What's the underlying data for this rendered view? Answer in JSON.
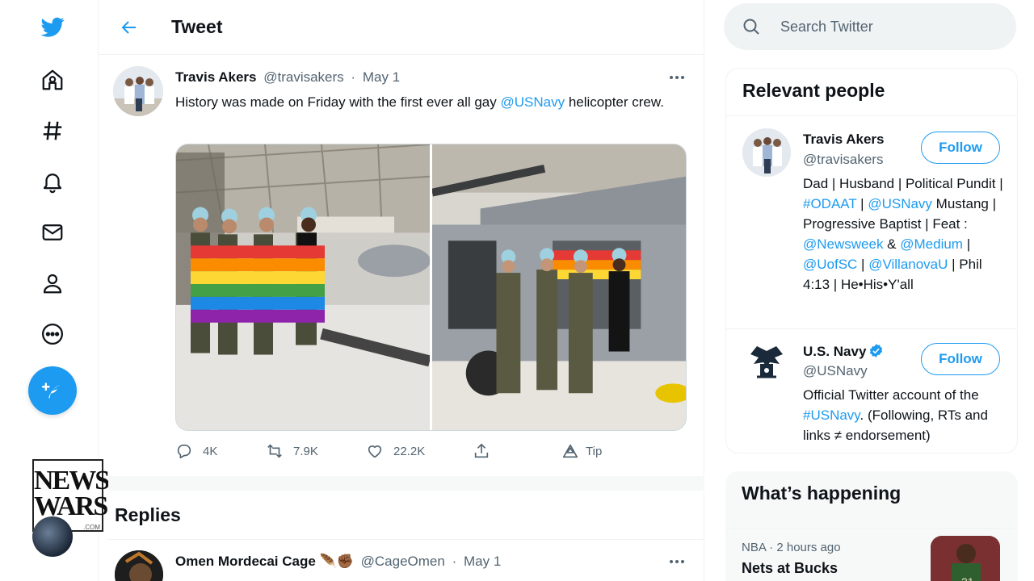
{
  "header": {
    "title": "Tweet"
  },
  "nav": {
    "items": [
      "twitter-logo",
      "home",
      "explore",
      "notifications",
      "messages",
      "profile",
      "more"
    ]
  },
  "overlay": {
    "brand_line1": "NEWS",
    "brand_line2": "WARS",
    "brand_domain": ".COM"
  },
  "tweet": {
    "author_name": "Travis Akers",
    "author_handle": "@travisakers",
    "date": "May 1",
    "text_before": "History was made on Friday with the first ever all gay ",
    "text_mention": "@USNavy",
    "text_after": " helicopter crew.",
    "stats": {
      "replies": "4K",
      "retweets": "7.9K",
      "likes": "22.2K",
      "tip": "Tip"
    }
  },
  "replies": {
    "title": "Replies",
    "first": {
      "author_name": "Omen Mordecai Cage",
      "emoji": "🪶✊🏾",
      "handle": "@CageOmen",
      "date": "May 1"
    }
  },
  "search": {
    "placeholder": "Search Twitter"
  },
  "relevant_people": {
    "title": "Relevant people",
    "people": [
      {
        "name": "Travis Akers",
        "handle": "@travisakers",
        "follow_label": "Follow",
        "bio_parts": [
          {
            "t": "Dad | Husband | Political Pundit | ",
            "link": false
          },
          {
            "t": "#ODAAT",
            "link": true
          },
          {
            "t": " | ",
            "link": false
          },
          {
            "t": "@USNavy",
            "link": true
          },
          {
            "t": " Mustang | Progressive Baptist | Feat : ",
            "link": false
          },
          {
            "t": "@Newsweek",
            "link": true
          },
          {
            "t": " & ",
            "link": false
          },
          {
            "t": "@Medium",
            "link": true
          },
          {
            "t": " | ",
            "link": false
          },
          {
            "t": "@UofSC",
            "link": true
          },
          {
            "t": " | ",
            "link": false
          },
          {
            "t": "@VillanovaU",
            "link": true
          },
          {
            "t": " | Phil 4:13 | He•His•Y'all",
            "link": false
          }
        ]
      },
      {
        "name": "U.S. Navy",
        "handle": "@USNavy",
        "follow_label": "Follow",
        "bio_parts": [
          {
            "t": "Official Twitter account of the ",
            "link": false
          },
          {
            "t": "#USNavy",
            "link": true
          },
          {
            "t": ". (Following, RTs and links ≠ endorsement)",
            "link": false
          }
        ]
      }
    ]
  },
  "whats_happening": {
    "title": "What’s happening",
    "trend": {
      "meta": "NBA · 2 hours ago",
      "title": "Nets at Bucks"
    }
  },
  "colors": {
    "accent": "#1d9bf0",
    "text": "#0f1419",
    "muted": "#536471",
    "border": "#eff3f4"
  }
}
